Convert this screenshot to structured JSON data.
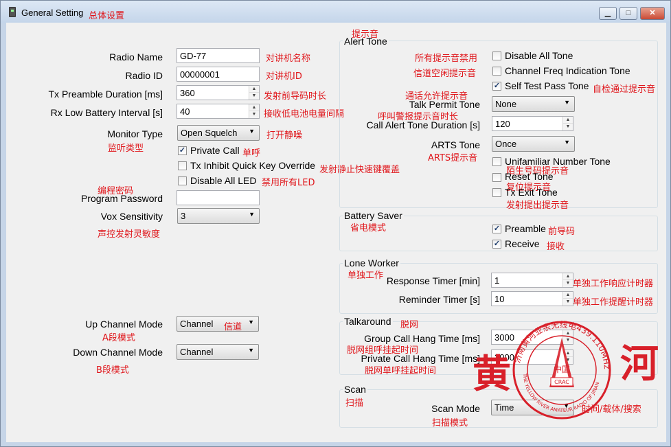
{
  "window": {
    "title": "General Setting",
    "title_cn": "总体设置",
    "buttons": [
      "▁",
      "□",
      "✕"
    ]
  },
  "left": {
    "radio_name": {
      "label": "Radio Name",
      "value": "GD-77",
      "cn": "对讲机名称"
    },
    "radio_id": {
      "label": "Radio ID",
      "value": "00000001",
      "cn": "对讲机ID"
    },
    "tx_preamble": {
      "label": "Tx Preamble Duration [ms]",
      "value": "360",
      "cn": "发射前导码时长"
    },
    "rx_low_battery": {
      "label": "Rx Low Battery Interval [s]",
      "value": "40",
      "cn": "接收低电池电量间隔"
    },
    "monitor_type": {
      "label": "Monitor Type",
      "value": "Open Squelch",
      "cn_under": "监听类型",
      "cn": "打开静噪"
    },
    "private_call": {
      "label": "Private Call",
      "checked": true,
      "cn": "单呼"
    },
    "tx_inhibit": {
      "label": "Tx Inhibit Quick Key Override",
      "checked": false,
      "cn": "发射静止快速键覆盖"
    },
    "disable_led": {
      "label": "Disable All LED",
      "checked": false,
      "cn": "禁用所有LED"
    },
    "program_password": {
      "label": "Program Password",
      "value": "",
      "cn": "编程密码"
    },
    "vox_sensitivity": {
      "label": "Vox Sensitivity",
      "value": "3",
      "cn": "声控发射灵敏度"
    },
    "up_channel_mode": {
      "label": "Up Channel Mode",
      "value": "Channel",
      "value_cn": "信道",
      "cn": "A段模式"
    },
    "down_channel_mode": {
      "label": "Down Channel Mode",
      "value": "Channel",
      "cn": "B段模式"
    }
  },
  "alert_tone": {
    "title": "Alert Tone",
    "title_cn": "提示音",
    "disable_all": {
      "label": "Disable All Tone",
      "checked": false,
      "cn": "所有提示音禁用"
    },
    "channel_freq": {
      "label": "Channel Freq Indication Tone",
      "checked": false,
      "cn": "信道空闲提示音"
    },
    "self_test": {
      "label": "Self Test Pass Tone",
      "checked": true,
      "cn": "自检通过提示音"
    },
    "talk_permit": {
      "label": "Talk Permit Tone",
      "value": "None",
      "cn": "通话允许提示音"
    },
    "call_alert": {
      "label": "Call Alert Tone Duration [s]",
      "value": "120",
      "cn": "呼叫警报提示音时长"
    },
    "arts": {
      "label": "ARTS Tone",
      "value": "Once",
      "cn": "ARTS提示音"
    },
    "unfamiliar": {
      "label": "Unifamiliar Number Tone",
      "checked": false,
      "cn": "陌生号码提示音"
    },
    "reset": {
      "label": "Reset Tone",
      "checked": false,
      "cn": "复位提示音"
    },
    "tx_exit": {
      "label": "Tx Exit Tone",
      "checked": false,
      "cn": "发射提出提示音"
    }
  },
  "battery_saver": {
    "title": "Battery Saver",
    "title_cn": "省电模式",
    "preamble": {
      "label": "Preamble",
      "checked": true,
      "cn": "前导码"
    },
    "receive": {
      "label": "Receive",
      "checked": true,
      "cn": "接收"
    }
  },
  "lone_worker": {
    "title": "Lone Worker",
    "title_cn": "单独工作",
    "response": {
      "label": "Response Timer [min]",
      "value": "1",
      "cn": "单独工作响应计时器"
    },
    "reminder": {
      "label": "Reminder Timer [s]",
      "value": "10",
      "cn": "单独工作提醒计时器"
    }
  },
  "talkaround": {
    "title": "Talkaround",
    "title_cn": "脱网",
    "group_hang": {
      "label": "Group Call Hang Time [ms]",
      "value": "3000",
      "cn": "脱网组呼挂起时间"
    },
    "private_hang": {
      "label": "Private Call Hang Time [ms]",
      "value": "3000",
      "cn": "脱网单呼挂起时间"
    }
  },
  "scan": {
    "title": "Scan",
    "title_cn": "扫描",
    "mode": {
      "label": "Scan Mode",
      "value": "Time",
      "cn": "扫描模式",
      "cn_right": "时间/载体/搜索"
    }
  },
  "seal": {
    "ring_text": "济南黄河业余无线电439.110MHz",
    "ring_text_bottom": "THE YELLOW RIVER AMATEUR RADIO OF JINAN",
    "center": "中国",
    "badge": "CRAC",
    "big_char_left": "黄",
    "big_char_right": "河",
    "color": "#d8202a"
  },
  "colors": {
    "annotation": "#e0161b",
    "window_frame": "#c6d5e8",
    "client": "#f0f0f0"
  }
}
